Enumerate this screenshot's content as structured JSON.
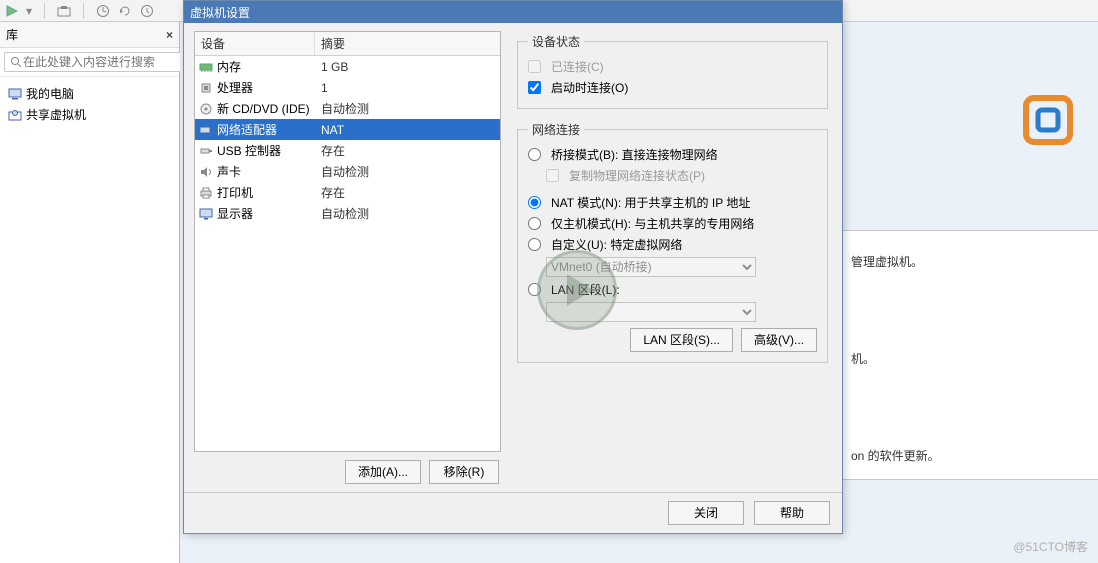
{
  "toolbar": {
    "icons": [
      "play-icon",
      "snapshot-icon",
      "clock-icon",
      "refresh-icon",
      "clock2-icon"
    ]
  },
  "library": {
    "title": "库",
    "search_placeholder": "在此处键入内容进行搜索",
    "items": [
      {
        "icon": "computer-icon",
        "label": "我的电脑"
      },
      {
        "icon": "shared-vm-icon",
        "label": "共享虚拟机"
      }
    ]
  },
  "background": {
    "line1": "管理虚拟机。",
    "line2": "机。",
    "line3": "on 的软件更新。",
    "watermark": "@51CTO博客"
  },
  "dialog": {
    "title": "虚拟机设置",
    "device_col": "设备",
    "summary_col": "摘要",
    "devices": [
      {
        "icon": "memory-icon",
        "name": "内存",
        "summary": "1 GB"
      },
      {
        "icon": "cpu-icon",
        "name": "处理器",
        "summary": "1"
      },
      {
        "icon": "cd-icon",
        "name": "新 CD/DVD (IDE)",
        "summary": "自动检测"
      },
      {
        "icon": "network-icon",
        "name": "网络适配器",
        "summary": "NAT"
      },
      {
        "icon": "usb-icon",
        "name": "USB 控制器",
        "summary": "存在"
      },
      {
        "icon": "sound-icon",
        "name": "声卡",
        "summary": "自动检测"
      },
      {
        "icon": "printer-icon",
        "name": "打印机",
        "summary": "存在"
      },
      {
        "icon": "display-icon",
        "name": "显示器",
        "summary": "自动检测"
      }
    ],
    "selected_device_index": 3,
    "add_btn": "添加(A)...",
    "remove_btn": "移除(R)",
    "status_group": "设备状态",
    "status_connected": "已连接(C)",
    "status_connect_on_start": "启动时连接(O)",
    "status_connected_checked": false,
    "status_start_checked": true,
    "net_group": "网络连接",
    "net_bridged": "桥接模式(B): 直接连接物理网络",
    "net_bridged_replicate": "复制物理网络连接状态(P)",
    "net_nat": "NAT 模式(N): 用于共享主机的 IP 地址",
    "net_hostonly": "仅主机模式(H): 与主机共享的专用网络",
    "net_custom": "自定义(U): 特定虚拟网络",
    "net_custom_value": "VMnet0 (自动桥接)",
    "net_lan": "LAN 区段(L):",
    "net_selected": "nat",
    "lan_segments_btn": "LAN 区段(S)...",
    "advanced_btn": "高级(V)...",
    "close_btn": "关闭",
    "help_btn": "帮助"
  }
}
